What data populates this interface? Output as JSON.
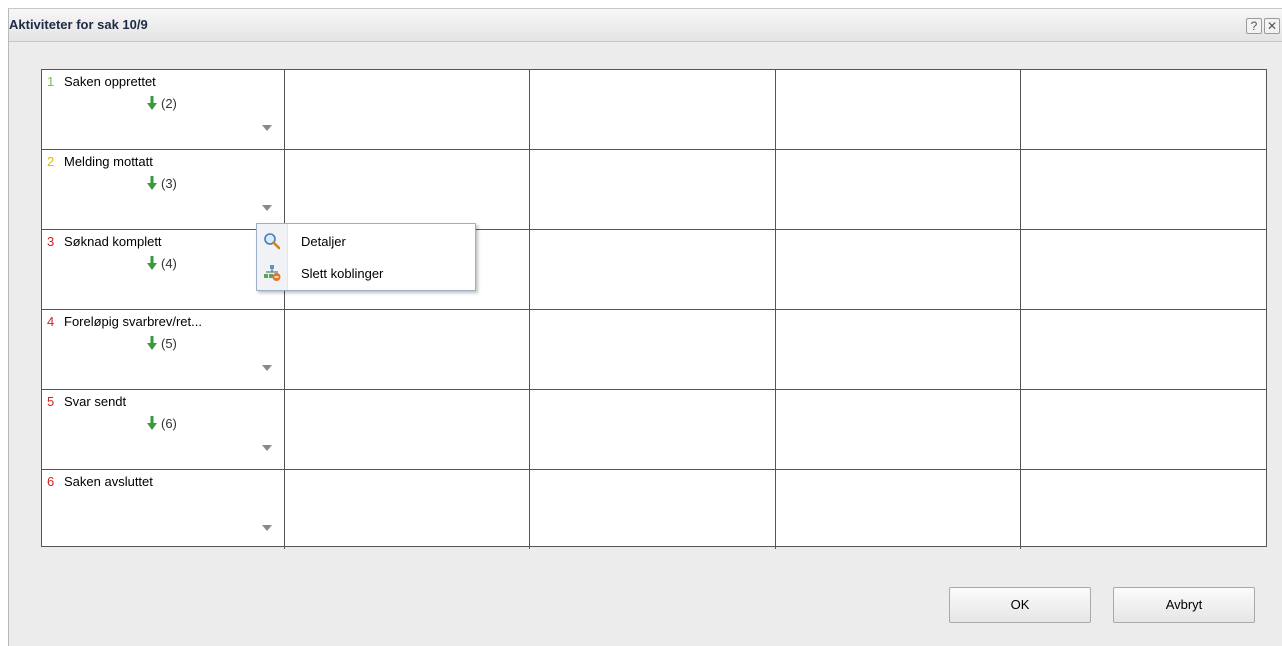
{
  "dialog": {
    "title": "Aktiviteter for sak 10/9",
    "help_label": "?",
    "close_label": "✕"
  },
  "activities": [
    {
      "num": "1",
      "num_color": "#7cc04a",
      "label": "Saken opprettet",
      "link": "(2)"
    },
    {
      "num": "2",
      "num_color": "#e6b800",
      "label": "Melding mottatt",
      "link": "(3)"
    },
    {
      "num": "3",
      "num_color": "#d42020",
      "label": "Søknad komplett",
      "link": "(4)"
    },
    {
      "num": "4",
      "num_color": "#d42020",
      "label": "Foreløpig svarbrev/ret...",
      "link": "(5)"
    },
    {
      "num": "5",
      "num_color": "#d42020",
      "label": "Svar sendt",
      "link": "(6)"
    },
    {
      "num": "6",
      "num_color": "#d42020",
      "label": "Saken avsluttet",
      "link": null
    }
  ],
  "context_menu": {
    "items": [
      {
        "label": "Detaljer",
        "icon": "magnifier-icon"
      },
      {
        "label": "Slett koblinger",
        "icon": "delete-links-icon"
      }
    ]
  },
  "buttons": {
    "ok": "OK",
    "cancel": "Avbryt"
  },
  "colors": {
    "arrow": "#3a9a3a",
    "title": "#1f2a44"
  }
}
